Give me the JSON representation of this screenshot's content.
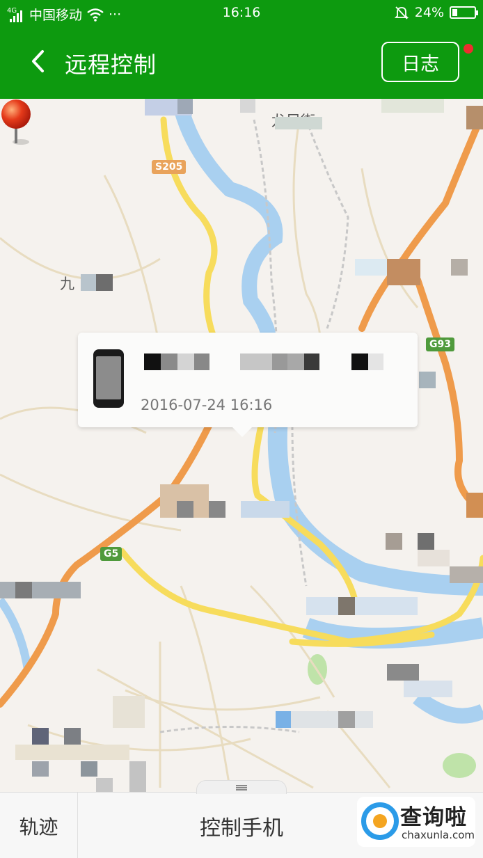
{
  "status_bar": {
    "network_type": "4G",
    "carrier": "中国移动",
    "more": "···",
    "time": "16:16",
    "battery_percent": "24%",
    "battery_level": 0.24
  },
  "header": {
    "title": "远程控制",
    "log_button": "日志"
  },
  "map": {
    "road_badges": [
      "S205",
      "G93",
      "G5"
    ],
    "place_fragments": [
      "龙凤街",
      "九"
    ],
    "pin_color": "#e53a1a"
  },
  "device_card": {
    "timestamp": "2016-07-24 16:16"
  },
  "bottom_bar": {
    "track_tab": "轨迹",
    "control_button": "控制手机"
  },
  "watermark": {
    "title": "查询啦",
    "url": "chaxunla.com"
  },
  "colors": {
    "header_green": "#0d9a0f",
    "highway_orange": "#ef9b4b",
    "road_yellow": "#f7dc5c",
    "river_blue": "#a9d0f0"
  }
}
